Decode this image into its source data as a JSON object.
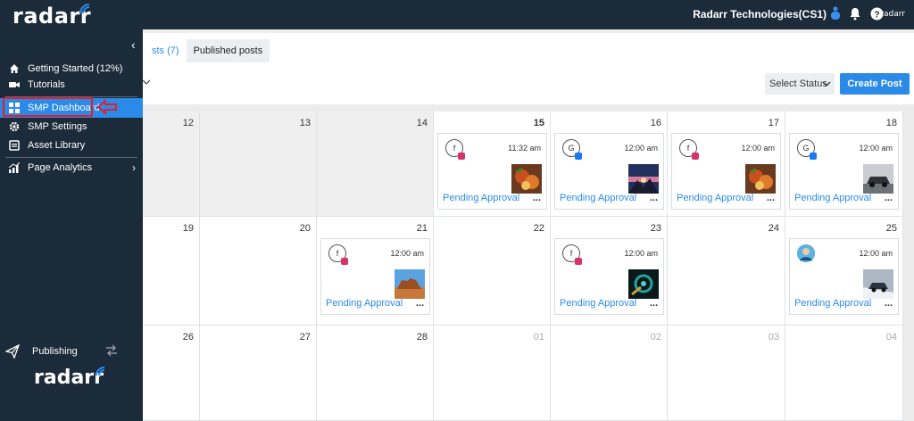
{
  "topbar": {
    "brand": "radarr",
    "org_name": "Radarr Technologies(CS1)",
    "brand_mini": "radarr",
    "icons": [
      "hand-pointer-icon",
      "bell-icon",
      "help-icon"
    ]
  },
  "sidebar": {
    "items": [
      {
        "label": "Getting Started (12%)",
        "icon": "home-icon"
      },
      {
        "label": "Tutorials",
        "icon": "video-icon"
      },
      {
        "label": "SMP Dashboard",
        "icon": "grid-icon",
        "active": true
      },
      {
        "label": "SMP Settings",
        "icon": "gear-icon"
      },
      {
        "label": "Asset Library",
        "icon": "library-icon"
      },
      {
        "label": "Page Analytics",
        "icon": "chart-icon"
      }
    ],
    "publishing_label": "Publishing",
    "bottom_brand": "radarr"
  },
  "tabs": [
    {
      "label": "sts (7)"
    },
    {
      "label": "Published posts"
    }
  ],
  "filters": {
    "status_placeholder": "Select Status",
    "create_label": "Create Post"
  },
  "calendar": {
    "days": [
      {
        "num": "12",
        "grey": true
      },
      {
        "num": "13",
        "grey": true
      },
      {
        "num": "14",
        "grey": true
      },
      {
        "num": "15",
        "bold": true,
        "post": {
          "avatar": "f",
          "network": "instagram",
          "time": "11:32 am",
          "thumb": "food",
          "status": "Pending Approval"
        }
      },
      {
        "num": "16",
        "post": {
          "avatar": "G",
          "network": "facebook",
          "time": "12:00 am",
          "thumb": "sunset",
          "status": "Pending Approval"
        }
      },
      {
        "num": "17",
        "post": {
          "avatar": "f",
          "network": "instagram",
          "time": "12:00 am",
          "thumb": "food",
          "status": "Pending Approval"
        }
      },
      {
        "num": "18",
        "post": {
          "avatar": "G",
          "network": "facebook",
          "time": "12:00 am",
          "thumb": "car",
          "status": "Pending Approval"
        }
      },
      {
        "num": "19"
      },
      {
        "num": "20"
      },
      {
        "num": "21",
        "post": {
          "avatar": "f",
          "network": "instagram",
          "time": "12:00 am",
          "thumb": "desert",
          "status": "Pending Approval"
        }
      },
      {
        "num": "22"
      },
      {
        "num": "23",
        "post": {
          "avatar": "f",
          "network": "instagram",
          "time": "12:00 am",
          "thumb": "tech",
          "status": "Pending Approval"
        }
      },
      {
        "num": "24"
      },
      {
        "num": "25",
        "post": {
          "avatar": "photo",
          "network": "none",
          "time": "12:00 am",
          "thumb": "snow",
          "status": "Pending Approval"
        }
      },
      {
        "num": "26"
      },
      {
        "num": "27"
      },
      {
        "num": "28"
      },
      {
        "num": "01",
        "muted": true
      },
      {
        "num": "02",
        "muted": true
      },
      {
        "num": "03",
        "muted": true
      },
      {
        "num": "04",
        "muted": true
      }
    ],
    "more_label": "..."
  },
  "colors": {
    "sidebar_bg": "#1c2b3a",
    "accent": "#2b8ae8",
    "highlight_border": "#e0202a"
  }
}
